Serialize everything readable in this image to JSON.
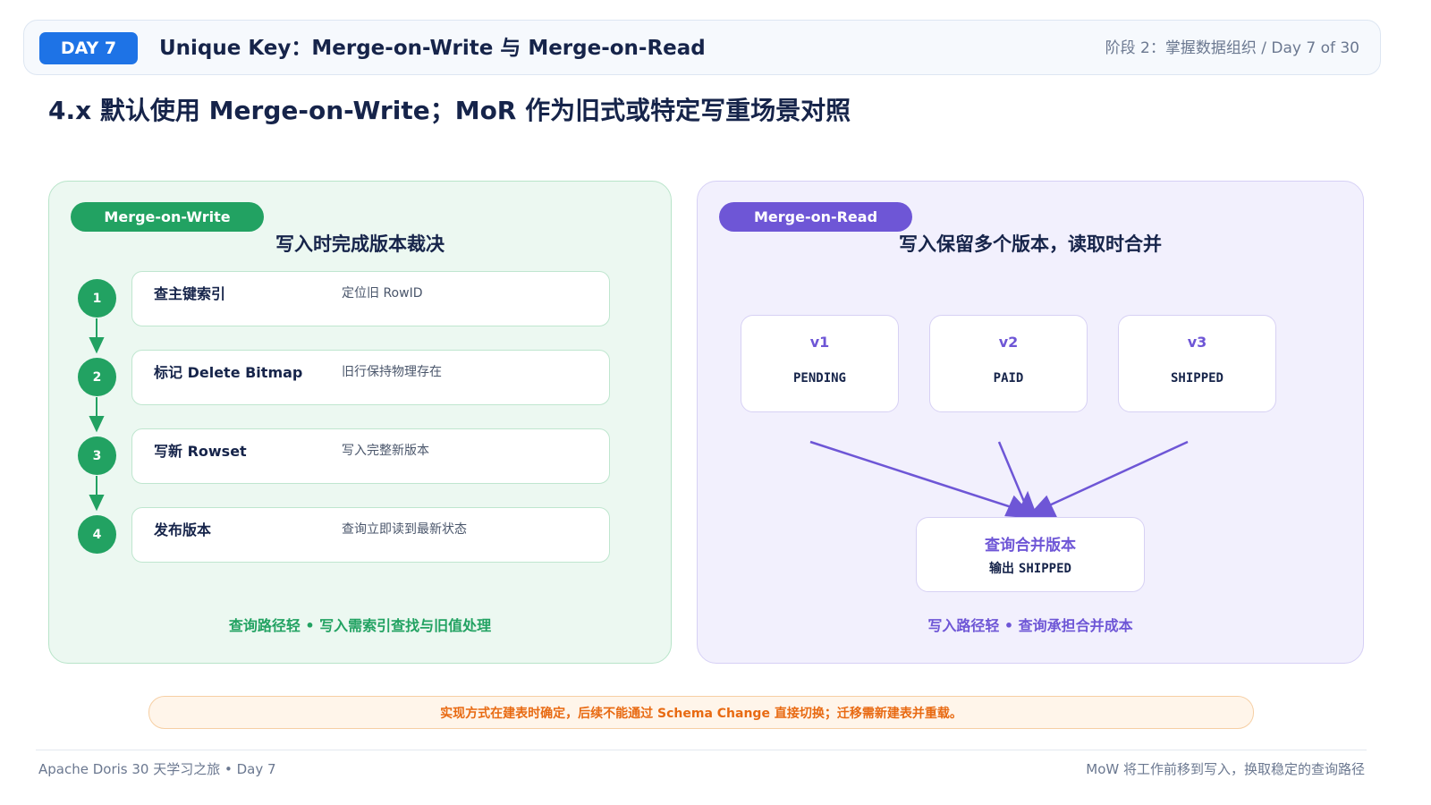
{
  "header": {
    "day_badge": "DAY 7",
    "title": "Unique Key：Merge-on-Write 与 Merge-on-Read",
    "progress": "阶段 2：掌握数据组织 / Day 7 of 30"
  },
  "main_heading": "4.x 默认使用 Merge-on-Write；MoR 作为旧式或特定写重场景对照",
  "mow": {
    "tag": "Merge-on-Write",
    "title": "写入时完成版本裁决",
    "steps": [
      {
        "num": "1",
        "name": "查主键索引",
        "desc": "定位旧 RowID"
      },
      {
        "num": "2",
        "name": "标记 Delete Bitmap",
        "desc": "旧行保持物理存在"
      },
      {
        "num": "3",
        "name": "写新 Rowset",
        "desc": "写入完整新版本"
      },
      {
        "num": "4",
        "name": "发布版本",
        "desc": "查询立即读到最新状态"
      }
    ],
    "footer": "查询路径轻 • 写入需索引查找与旧值处理"
  },
  "mor": {
    "tag": "Merge-on-Read",
    "title": "写入保留多个版本，读取时合并",
    "versions": [
      {
        "label": "v1",
        "state": "PENDING"
      },
      {
        "label": "v2",
        "state": "PAID"
      },
      {
        "label": "v3",
        "state": "SHIPPED"
      }
    ],
    "merge": {
      "title": "查询合并版本",
      "output_prefix": "输出",
      "output_value": "SHIPPED"
    },
    "footer": "写入路径轻 • 查询承担合并成本"
  },
  "notice": "实现方式在建表时确定，后续不能通过 Schema Change 直接切换；迁移需新建表并重载。",
  "footer": {
    "left": "Apache Doris 30 天学习之旅 • Day 7",
    "right": "MoW 将工作前移到写入，换取稳定的查询路径"
  },
  "colors": {
    "accent_blue": "#1e73e6",
    "mow_green": "#22a262",
    "mor_purple": "#6e56d6",
    "notice_orange": "#e86a12",
    "ink": "#16244a"
  }
}
